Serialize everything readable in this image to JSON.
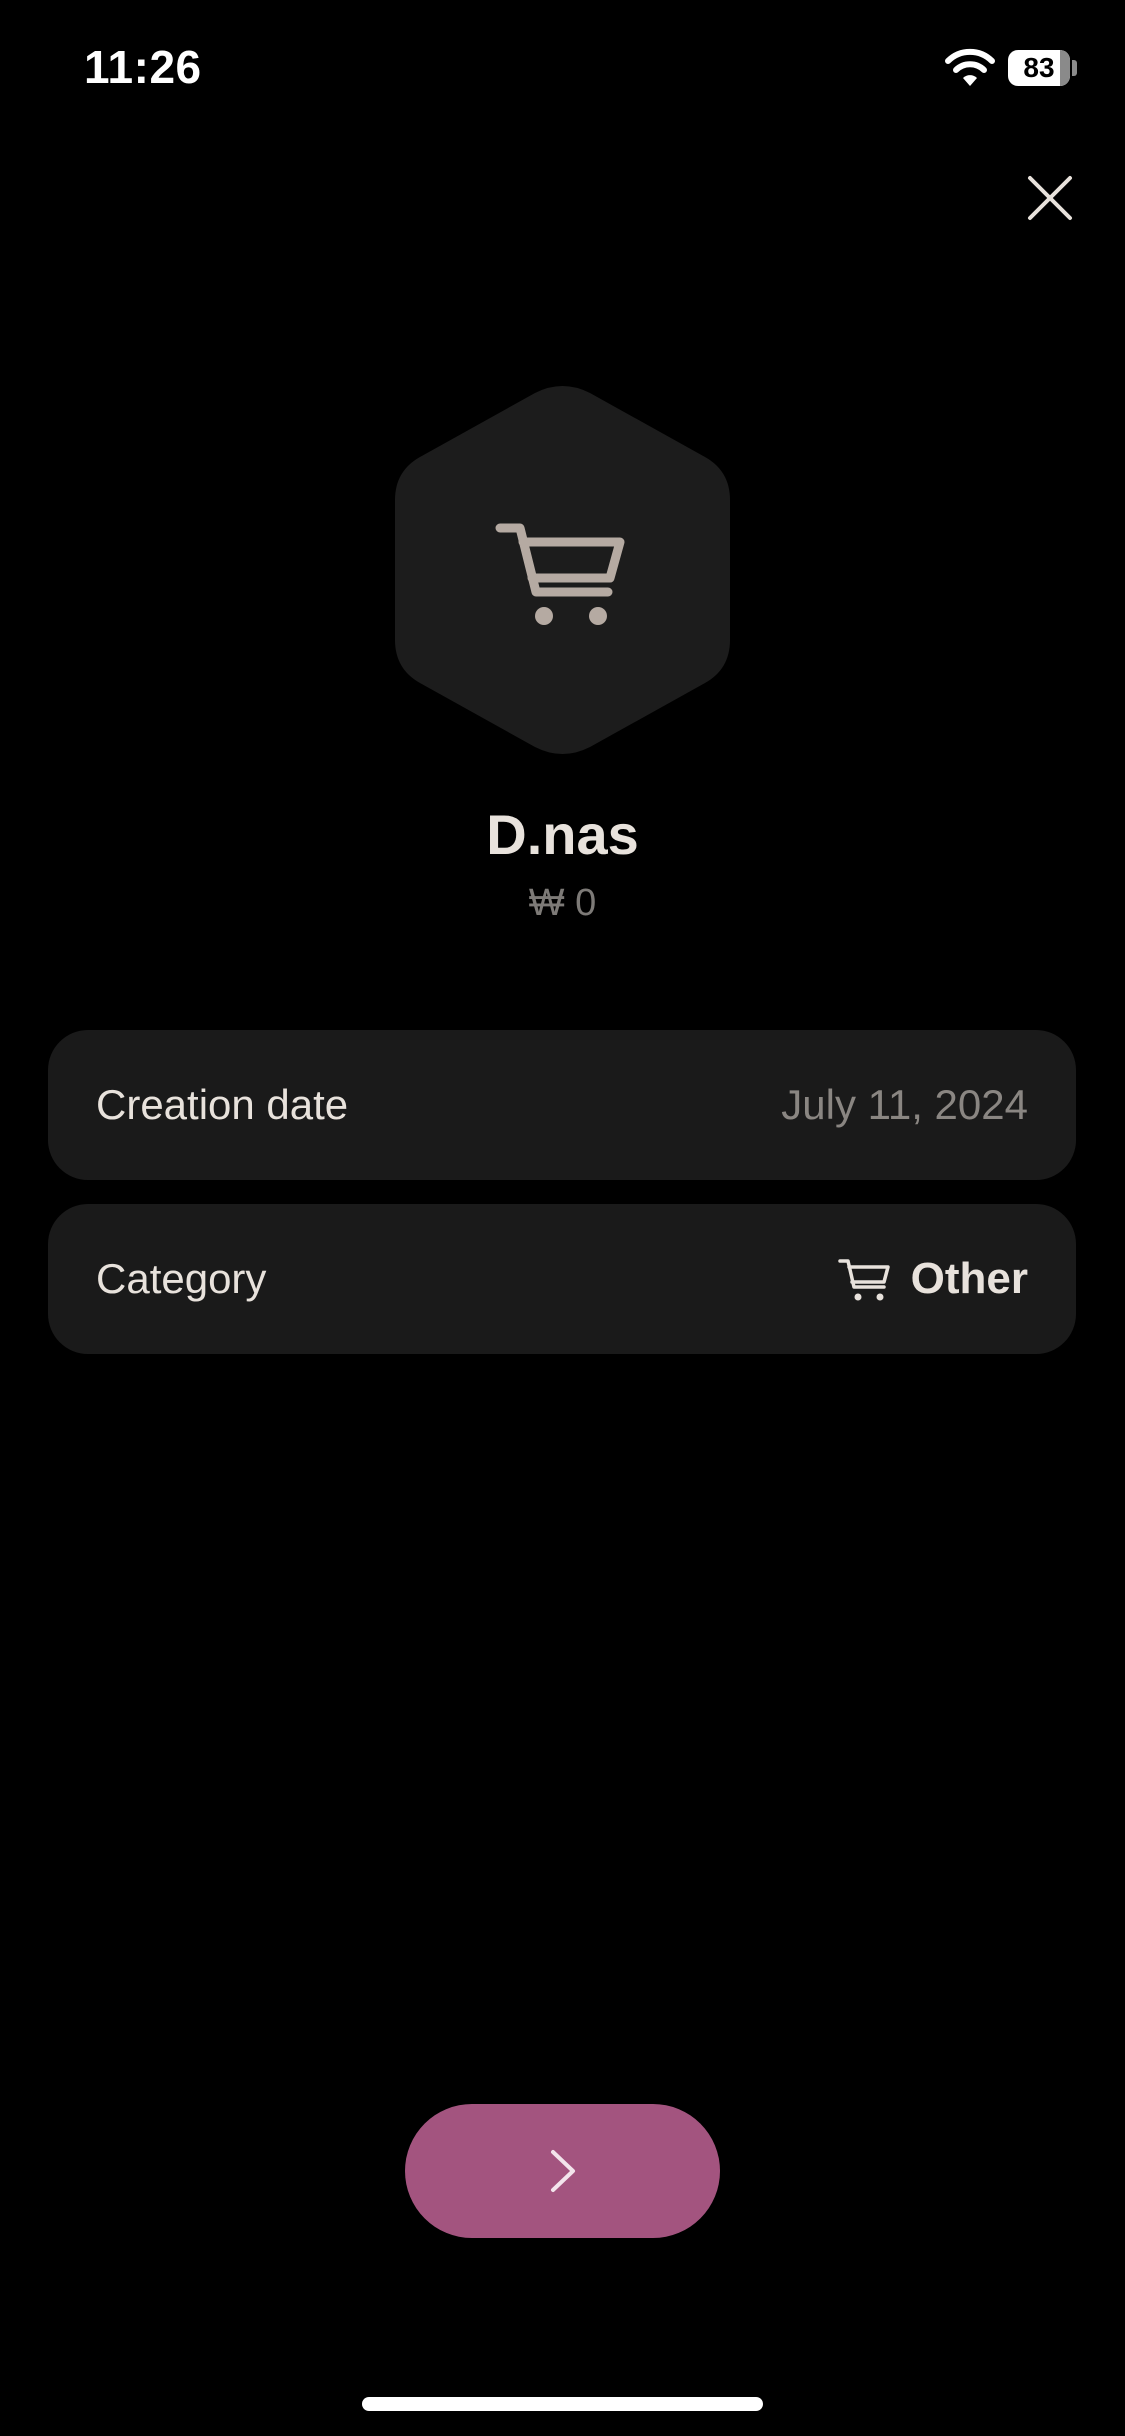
{
  "status_bar": {
    "time": "11:26",
    "battery_level": "83",
    "battery_fraction": 0.83,
    "icons": [
      "wifi-icon",
      "battery-icon"
    ]
  },
  "header": {
    "close_icon": "close-icon"
  },
  "account": {
    "badge_icon": "shopping-cart-icon",
    "name": "D.nas",
    "balance": "₩ 0"
  },
  "details": {
    "creation_date": {
      "label": "Creation date",
      "value": "July 11, 2024"
    },
    "category": {
      "label": "Category",
      "value": "Other",
      "icon": "shopping-cart-icon"
    }
  },
  "footer": {
    "next_icon": "chevron-right-icon"
  },
  "colors": {
    "background": "#000000",
    "card": "#1a1a1a",
    "badge": "#1c1c1c",
    "text_primary": "#e8e2dc",
    "text_secondary": "#8a8682",
    "accent": "#a3547f",
    "icon_tint": "#b5aaa2"
  }
}
